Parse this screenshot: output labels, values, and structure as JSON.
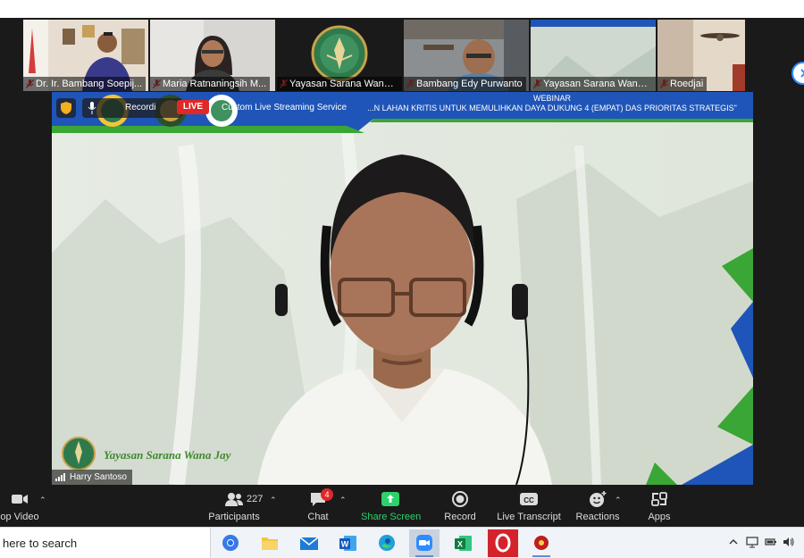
{
  "participants": [
    {
      "name": "Dr. Ir. Bambang Soepij...",
      "muted": true
    },
    {
      "name": "Maria Ratnaningsih M...",
      "muted": true
    },
    {
      "name": "Yayasan Sarana Wana ...",
      "muted": true
    },
    {
      "name": "Bambang Edy Purwanto",
      "muted": true
    },
    {
      "name": "Yayasan Sarana Wana ...",
      "muted": true
    },
    {
      "name": "Roedjai",
      "muted": true
    }
  ],
  "banner": {
    "heading": "WEBINAR",
    "subheading": "...N LAHAN KRITIS UNTUK MEMULIHKAN DAYA DUKUNG 4 (EMPAT) DAS PRIORITAS STRATEGIS\"",
    "recording_label": "Recordi",
    "live_label": "LIVE",
    "stream_label": "Custom Live Streaming Service"
  },
  "main": {
    "watermark_text": "Yayasan Sarana Wana Jay",
    "speaker_name": "Harry Santoso"
  },
  "toolbar": {
    "video_label": "op Video",
    "participants_label": "Participants",
    "participants_count": "227",
    "chat_label": "Chat",
    "chat_badge": "4",
    "share_label": "Share Screen",
    "record_label": "Record",
    "transcript_label": "Live Transcript",
    "reactions_label": "Reactions",
    "apps_label": "Apps"
  },
  "taskbar": {
    "search_text": "here to search"
  },
  "colors": {
    "banner_blue": "#1f55b8",
    "banner_green": "#3aa635",
    "share_green": "#2ed16b",
    "live_red": "#e02828",
    "zoom_blue": "#2d8cff"
  }
}
